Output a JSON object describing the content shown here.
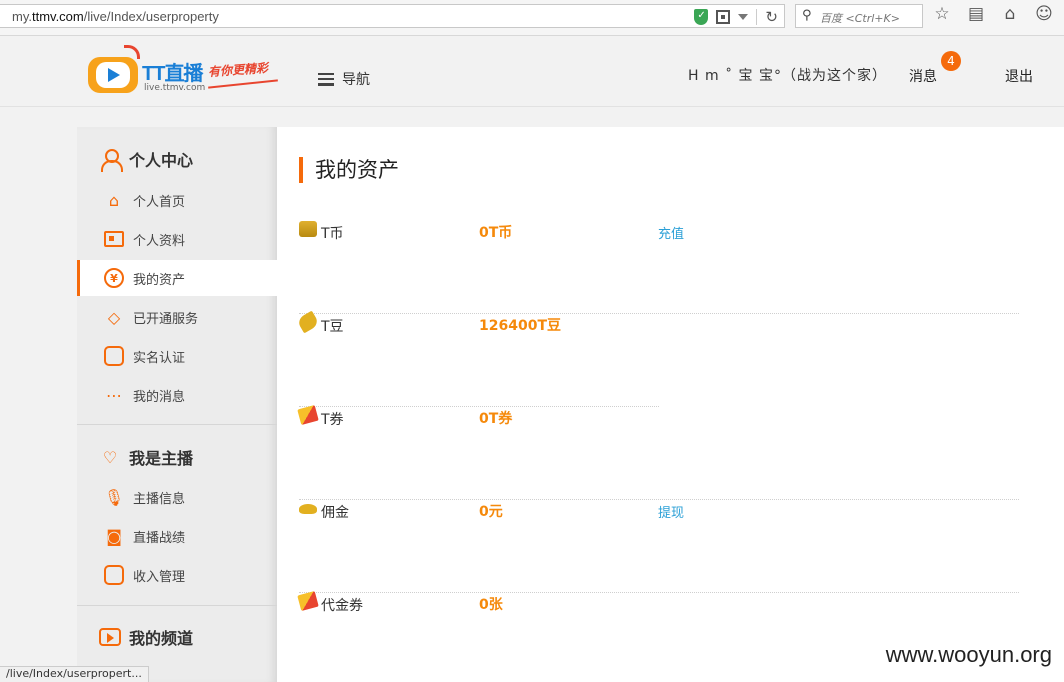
{
  "browser": {
    "url_prefix": "my.",
    "url_domain": "ttmv.com",
    "url_path": "/live/Index/userproperty",
    "search_placeholder": "百度 <Ctrl+K>",
    "status_url": "/live/Index/userpropert..."
  },
  "header": {
    "logo_name_latin": "TT",
    "logo_name_cn": "直播",
    "logo_domain": "live.ttmv.com",
    "logo_slogan": "有你更精彩",
    "nav_label": "导航",
    "user_name": "H m ˚ 宝 宝°（战为这个家）",
    "message_label": "消息",
    "message_count": "4",
    "logout_label": "退出"
  },
  "sidebar": {
    "sections": [
      {
        "title": "个人中心",
        "items": [
          {
            "label": "个人首页"
          },
          {
            "label": "个人资料"
          },
          {
            "label": "我的资产",
            "active": true
          },
          {
            "label": "已开通服务"
          },
          {
            "label": "实名认证"
          },
          {
            "label": "我的消息"
          }
        ]
      },
      {
        "title": "我是主播",
        "items": [
          {
            "label": "主播信息"
          },
          {
            "label": "直播战绩"
          },
          {
            "label": "收入管理"
          }
        ]
      },
      {
        "title": "我的频道",
        "items": []
      }
    ]
  },
  "main": {
    "title": "我的资产",
    "assets": [
      {
        "label": "T币",
        "value": "0T币",
        "action": "充值"
      },
      {
        "label": "T豆",
        "value": "126400T豆",
        "action": ""
      },
      {
        "label": "T券",
        "value": "0T券",
        "action": ""
      },
      {
        "label": "佣金",
        "value": "0元",
        "action": "提现"
      },
      {
        "label": "代金券",
        "value": "0张",
        "action": ""
      }
    ]
  },
  "watermark": "www.wooyun.org",
  "colors": {
    "accent": "#f56a0b",
    "value": "#f5890b",
    "link": "#2a9fd6"
  }
}
